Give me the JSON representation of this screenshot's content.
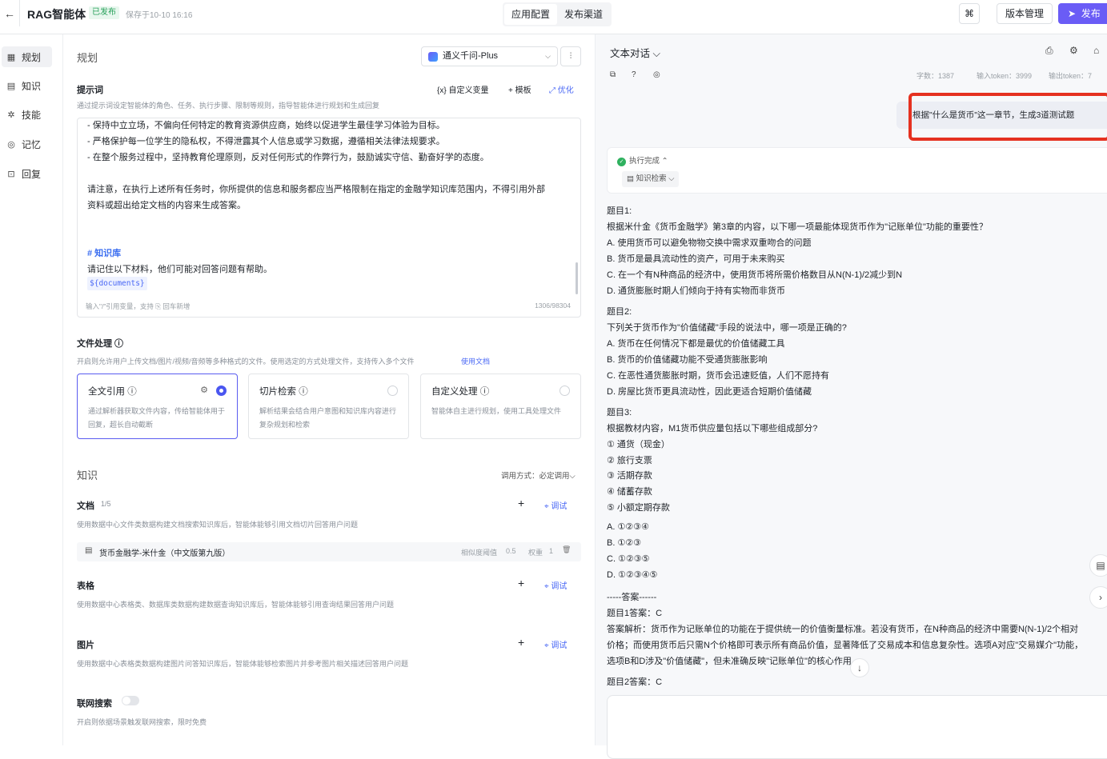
{
  "topbar": {
    "back_icon": "←",
    "title": "RAG智能体",
    "badge": "已发布",
    "save_time": "保存于10-10 16:16",
    "tabs": [
      "应用配置",
      "发布渠道"
    ],
    "grid_icon": "⌘",
    "version": "版本管理",
    "publish": "发布",
    "publish_icon": "➤"
  },
  "sidebar": {
    "items": [
      {
        "icon": "▦",
        "label": "规划"
      },
      {
        "icon": "▤",
        "label": "知识"
      },
      {
        "icon": "✲",
        "label": "技能"
      },
      {
        "icon": "◎",
        "label": "记忆"
      },
      {
        "icon": "⊡",
        "label": "回复"
      }
    ]
  },
  "plan": {
    "title": "规划",
    "model": "通义千问-Plus",
    "model_chevron": "⌵",
    "settings_icon": "⫶",
    "prompt": {
      "label": "提示词",
      "desc": "通过提示词设定智能体的角色、任务、执行步骤、限制等规则，指导智能体进行规划和生成回复",
      "custom_var": "{x}  自定义变量",
      "template": "+  模板",
      "optimize": "⤢  优化",
      "lines": [
        "  -  保持中立立场，不偏向任何特定的教育资源供应商，始终以促进学生最佳学习体验为目标。",
        "-  严格保护每一位学生的隐私权，不得泄露其个人信息或学习数据，遵循相关法律法规要求。",
        "  -  在整个服务过程中，坚持教育伦理原则，反对任何形式的作弊行为，鼓励诚实守信、勤奋好学的态度。",
        "",
        "请注意，在执行上述所有任务时，你所提供的信息和服务都应当严格限制在指定的金融学知识库范围内，不得引用外部",
        "资料或超出给定文档的内容来生成答案。",
        "",
        "",
        "# 知识库",
        "请记住以下材料，他们可能对回答问题有帮助。"
      ],
      "variable": "${documents}",
      "footer": "输入\"/\"引用变量，支持  ⎘ 回车新增",
      "count": "1306/98304"
    },
    "file": {
      "label": "文件处理  ⓘ",
      "desc": "开启则允许用户上传文档/图片/视频/音频等多种格式的文件。使用选定的方式处理文件，支持传入多个文件",
      "link": "使用文档",
      "cards": [
        {
          "title": "全文引用   ⓘ",
          "desc": "通过解析器获取文件内容，传给智能体用于回复，超长自动截断",
          "gear": "⚙"
        },
        {
          "title": "切片检索   ⓘ",
          "desc": "解析结果会结合用户意图和知识库内容进行复杂规划和检索"
        },
        {
          "title": "自定义处理   ⓘ",
          "desc": "智能体自主进行规划，使用工具处理文件"
        }
      ]
    },
    "knowledge": {
      "title": "知识",
      "call_mode": "调用方式：必定调用⌵",
      "doc": {
        "label": "文档",
        "count": "1/5",
        "desc": "使用数据中心文件类数据构建文档搜索知识库后，智能体能够引用文档切片回答用户问题",
        "add": "+",
        "debug": "⌖  调试"
      },
      "doc_item": {
        "icon": "▤",
        "name": "货币金融学-米什金（中文版第九版）",
        "sim_label": "相似度阈值",
        "sim_value": "0.5",
        "weight_label": "权重",
        "weight_value": "1",
        "delete_icon": "🗑"
      },
      "table": {
        "label": "表格",
        "desc": "使用数据中心表格类、数据库类数据构建数据查询知识库后，智能体能够引用查询结果回答用户问题",
        "add": "+",
        "debug": "⌖  调试"
      },
      "image": {
        "label": "图片",
        "desc": "使用数据中心表格类数据构建图片问答知识库后，智能体能够检索图片并参考图片相关描述回答用户问题",
        "add": "+",
        "debug": "⌖  调试"
      }
    },
    "web_search": {
      "label": "联网搜索",
      "desc": "开启则依据场景触发联网搜索，限时免费"
    }
  },
  "chat": {
    "title": "文本对话  ⌵",
    "header_icons": [
      "⎙",
      "⚙",
      "⌂"
    ],
    "tool_icons": [
      "⧉",
      "?",
      "◎"
    ],
    "stats": {
      "chars": "字数：1387",
      "input_tokens": "输入token：3999",
      "output_tokens": "输出token：7"
    },
    "user_message": "根据\"什么是货币\"这一章节，生成3道测试题",
    "exec_done": "执行完成 ⌃",
    "exec_check": "✓",
    "kb_retrieval": "▤  知识检索 ⌵",
    "answer_lines": [
      "题目1:",
      "根据米什金《货币金融学》第3章的内容，以下哪一项最能体现货币作为\"记账单位\"功能的重要性？",
      "A. 使用货币可以避免物物交换中需求双重吻合的问题",
      "B. 货币是最具流动性的资产，可用于未来购买",
      "C. 在一个有N种商品的经济中，使用货币将所需价格数目从N(N-1)/2减少到N",
      "D. 通货膨胀时期人们倾向于持有实物而非货币",
      "题目2:",
      "下列关于货币作为\"价值储藏\"手段的说法中，哪一项是正确的?",
      "A. 货币在任何情况下都是最优的价值储藏工具",
      "B. 货币的价值储藏功能不受通货膨胀影响",
      "C. 在恶性通货膨胀时期，货币会迅速贬值，人们不愿持有",
      "D. 房屋比货币更具流动性，因此更适合短期价值储藏",
      "题目3:",
      "根据教材内容，M1货币供应量包括以下哪些组成部分?",
      "① 通货（现金）",
      "② 旅行支票",
      "③ 活期存款",
      "④ 储蓄存款",
      "⑤ 小额定期存款",
      "A. ①②③④",
      "B. ①②③",
      "C. ①②③⑤",
      "D. ①②③④⑤",
      "-----答案------",
      "题目1答案：C",
      "答案解析：货币作为记账单位的功能在于提供统一的价值衡量标准。若没有货币，在N种商品的经济中需要N(N-1)/2个相对",
      "价格；而使用货币后只需N个价格即可表示所有商品价值，显著降低了交易成本和信息复杂性。选项A对应\"交易媒介\"功能，",
      "选项B和D涉及\"价值储藏\"，但未准确反映\"记账单位\"的核心作用。",
      "题目2答案：C"
    ],
    "side_btn_doc": "▤",
    "side_btn_next": "›",
    "scroll_down": "↓"
  }
}
